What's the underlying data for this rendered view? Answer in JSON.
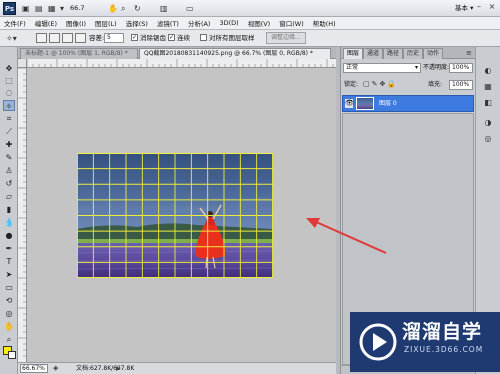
{
  "app": {
    "logo": "Ps",
    "zoom": "66.7",
    "workspace": "基本 ▾"
  },
  "menu": [
    "文件(F)",
    "编辑(E)",
    "图像(I)",
    "图层(L)",
    "选择(S)",
    "滤镜(T)",
    "分析(A)",
    "3D(D)",
    "视图(V)",
    "窗口(W)",
    "帮助(H)"
  ],
  "options": {
    "tolerance_label": "容差:",
    "tolerance_value": "5",
    "antialias_label": "消除锯齿",
    "contiguous_label": "连续",
    "sample_all_label": "对所有图层取样",
    "refine_edge_button": "调整边缘..."
  },
  "tabs": [
    {
      "label": "未标题-1 @ 100% (图层 1, RGB/8) *",
      "active": false
    },
    {
      "label": "QQ截图20180831140925.png @ 66.7% (图层 0, RGB/8) *",
      "active": true
    }
  ],
  "status": {
    "zoom": "66.67%",
    "doc": "文档:627.8K/627.8K"
  },
  "panels": {
    "tabs": [
      "图层",
      "通道",
      "路径",
      "历史",
      "动作"
    ],
    "blend_mode": "正常",
    "opacity_label": "不透明度:",
    "opacity": "100%",
    "lock_label": "锁定:",
    "fill_label": "填充:",
    "fill": "100%",
    "layer_name": "图层 0"
  },
  "watermark": {
    "title": "溜溜自学",
    "sub": "ZIXUE.3D66.COM"
  },
  "icons": {
    "toolbar": [
      "move-icon",
      "marquee-icon",
      "lasso-icon",
      "magic-wand-icon",
      "crop-icon",
      "eyedropper-icon",
      "healing-icon",
      "brush-icon",
      "clone-stamp-icon",
      "history-brush-icon",
      "eraser-icon",
      "gradient-icon",
      "blur-icon",
      "dodge-icon",
      "pen-icon",
      "type-icon",
      "path-select-icon",
      "shape-icon",
      "3d-rotate-icon",
      "3d-camera-icon",
      "hand-icon",
      "zoom-icon"
    ]
  },
  "colors": {
    "foreground": "#fff000",
    "background": "#ffffff",
    "grid": "#f0ec3a",
    "accent": "#3d7be0",
    "arrow": "#e03a3a"
  }
}
